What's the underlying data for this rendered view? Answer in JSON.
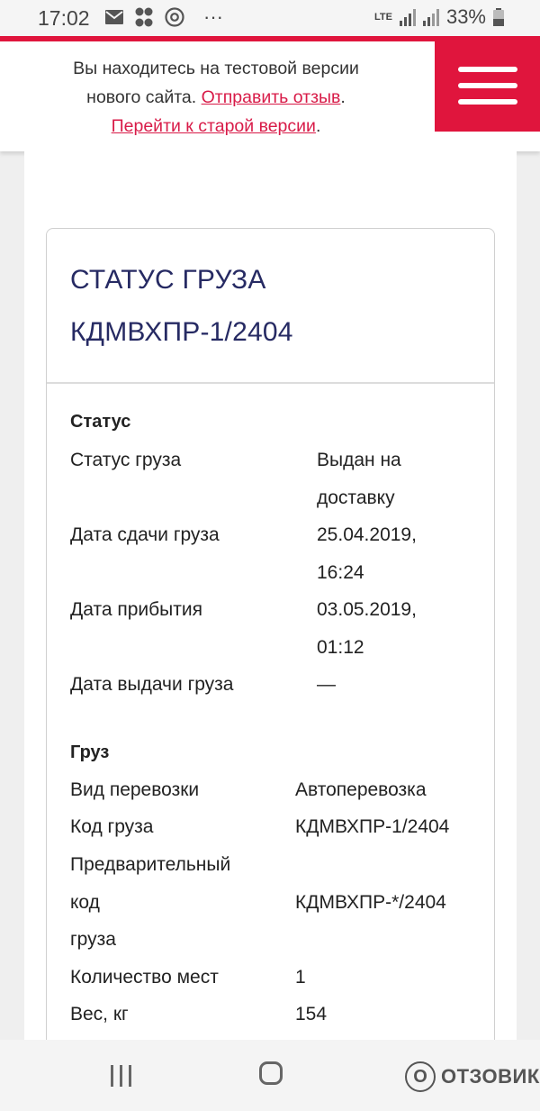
{
  "status_bar": {
    "time": "17:02",
    "network": "LTE",
    "battery": "33%",
    "more": "···"
  },
  "banner": {
    "line1": "Вы находитесь на тестовой версии",
    "line2_prefix": "нового сайта. ",
    "feedback_link": "Отправить отзыв",
    "line2_suffix": ".",
    "old_version_link": "Перейти к старой версии",
    "line3_suffix": "."
  },
  "card": {
    "title_line1": "СТАТУС ГРУЗА",
    "title_line2": "КДМВХПР-1/2404",
    "status_section": {
      "heading": "Статус",
      "rows": [
        {
          "label": "Статус груза",
          "value": [
            "Выдан на",
            "доставку"
          ]
        },
        {
          "label": "Дата сдачи груза",
          "value": [
            "25.04.2019,",
            "16:24"
          ]
        },
        {
          "label": "Дата прибытия",
          "value": [
            "03.05.2019,",
            "01:12"
          ]
        },
        {
          "label": "Дата выдачи груза",
          "value": [
            "—"
          ]
        }
      ]
    },
    "cargo_section": {
      "heading": "Груз",
      "rows": [
        {
          "label": [
            "Вид перевозки"
          ],
          "value": "Автоперевозка"
        },
        {
          "label": [
            "Код груза"
          ],
          "value": "КДМВХПР-1/2404"
        },
        {
          "label": [
            "Предварительный",
            "код",
            "груза"
          ],
          "value": "КДМВХПР-*/2404"
        },
        {
          "label": [
            "Количество мест"
          ],
          "value": "1"
        },
        {
          "label": [
            "Вес, кг"
          ],
          "value": "154"
        }
      ]
    }
  },
  "watermark": {
    "text": "ОТЗОВИК"
  },
  "colors": {
    "accent": "#e0153d",
    "link": "#d81b48",
    "title": "#262a63"
  }
}
